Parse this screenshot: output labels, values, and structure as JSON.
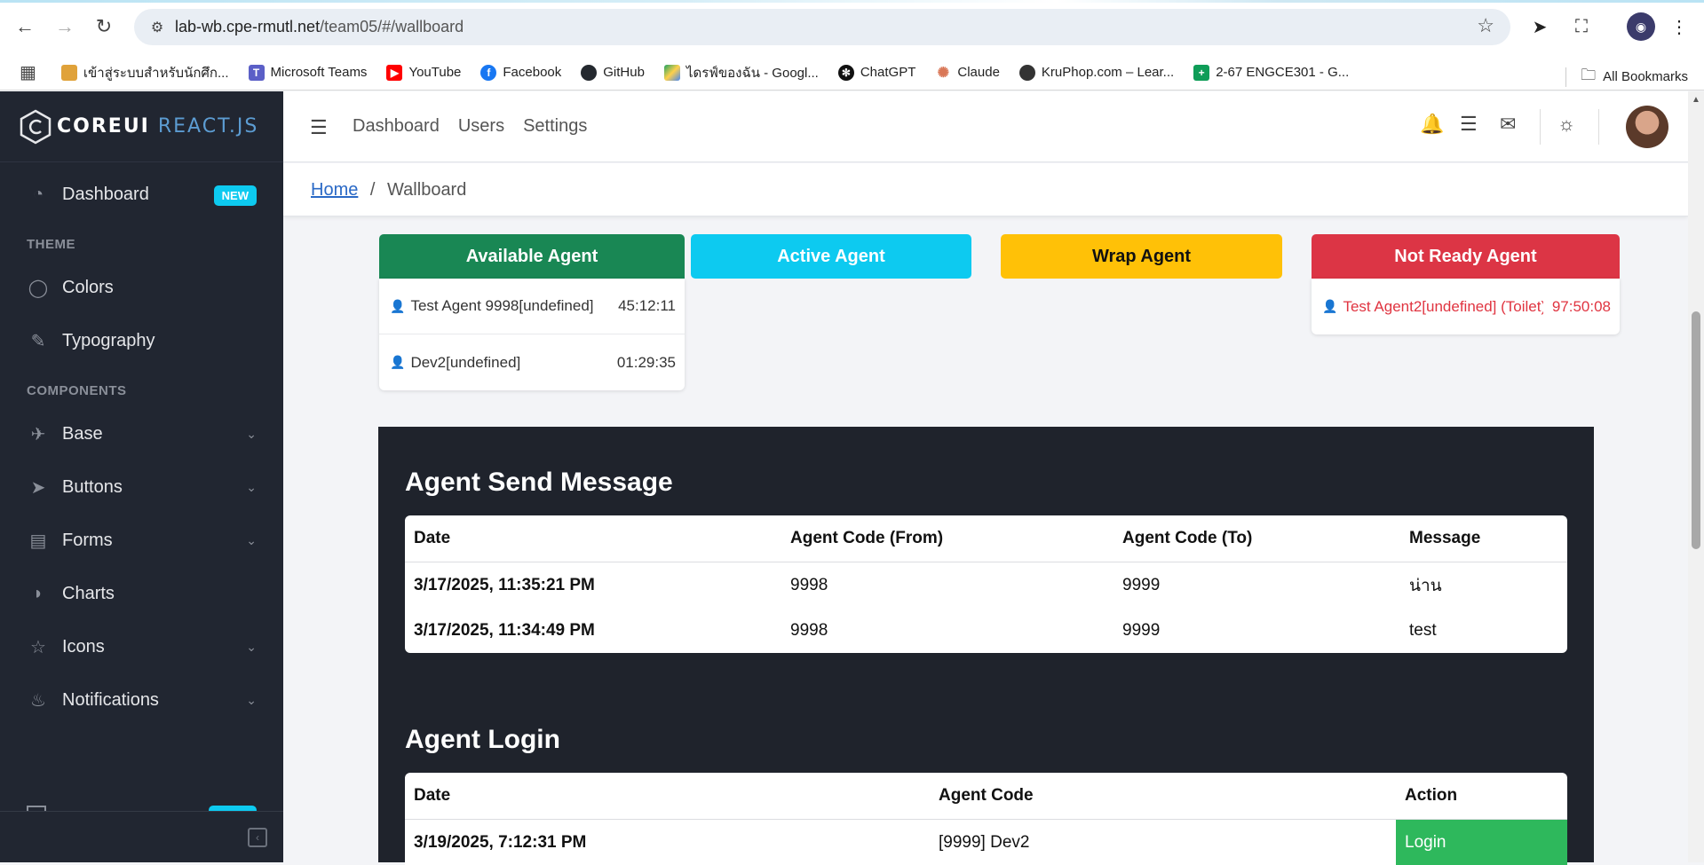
{
  "browser": {
    "url_host": "lab-wb.cpe-rmutl.net",
    "url_path": "/team05/#/wallboard",
    "bookmarks": [
      {
        "label": "เข้าสู่ระบบสำหรับนักศึก...",
        "icon": "torch-icon",
        "color": "#e0a23a"
      },
      {
        "label": "Microsoft Teams",
        "icon": "teams-icon",
        "color": "#5b5fc7"
      },
      {
        "label": "YouTube",
        "icon": "youtube-icon",
        "color": "#ff0000"
      },
      {
        "label": "Facebook",
        "icon": "facebook-icon",
        "color": "#1877f2"
      },
      {
        "label": "GitHub",
        "icon": "github-icon",
        "color": "#24292f"
      },
      {
        "label": "ไดรฟ์ของฉัน - Googl...",
        "icon": "google-drive-icon",
        "color": "#1fa463"
      },
      {
        "label": "ChatGPT",
        "icon": "chatgpt-icon",
        "color": "#111111"
      },
      {
        "label": "Claude",
        "icon": "claude-icon",
        "color": "#d97757"
      },
      {
        "label": "KruPhop.com – Lear...",
        "icon": "kruphop-icon",
        "color": "#333333"
      },
      {
        "label": "2-67 ENGCE301 - G...",
        "icon": "sheets-icon",
        "color": "#0f9d58"
      }
    ],
    "all_bookmarks": "All Bookmarks"
  },
  "sidebar": {
    "brand_bold": "COREUI",
    "brand_light": "REACT.JS",
    "dashboard": {
      "label": "Dashboard",
      "badge": "NEW"
    },
    "theme_title": "THEME",
    "theme_items": [
      {
        "label": "Colors",
        "icon": "drop-icon"
      },
      {
        "label": "Typography",
        "icon": "pencil-icon"
      }
    ],
    "components_title": "COMPONENTS",
    "component_items": [
      {
        "label": "Base",
        "icon": "puzzle-icon",
        "has_children": true
      },
      {
        "label": "Buttons",
        "icon": "cursor-icon",
        "has_children": true
      },
      {
        "label": "Forms",
        "icon": "notes-icon",
        "has_children": true
      },
      {
        "label": "Charts",
        "icon": "chart-pie-icon",
        "has_children": false
      },
      {
        "label": "Icons",
        "icon": "star-icon",
        "has_children": true
      },
      {
        "label": "Notifications",
        "icon": "bell-icon",
        "has_children": true
      }
    ]
  },
  "header": {
    "nav": [
      "Dashboard",
      "Users",
      "Settings"
    ]
  },
  "breadcrumb": {
    "home": "Home",
    "separator": "/",
    "current": "Wallboard"
  },
  "agent_status": {
    "available": {
      "title": "Available Agent",
      "color": "#198754",
      "agents": [
        {
          "name": "Test Agent 9998[undefined]",
          "time": "45:12:11"
        },
        {
          "name": "Dev2[undefined]",
          "time": "01:29:35"
        }
      ]
    },
    "active": {
      "title": "Active Agent",
      "color": "#0dcaf0",
      "agents": []
    },
    "wrap": {
      "title": "Wrap Agent",
      "color": "#ffc107",
      "agents": []
    },
    "not_ready": {
      "title": "Not Ready Agent",
      "color": "#dc3545",
      "agents": [
        {
          "name": "Test Agent2[undefined] (Toilet)",
          "time": "97:50:08"
        }
      ]
    }
  },
  "messages": {
    "title": "Agent Send Message",
    "columns": [
      "Date",
      "Agent Code (From)",
      "Agent Code (To)",
      "Message"
    ],
    "rows": [
      [
        "3/17/2025, 11:35:21 PM",
        "9998",
        "9999",
        "น่าน"
      ],
      [
        "3/17/2025, 11:34:49 PM",
        "9998",
        "9999",
        "test"
      ]
    ]
  },
  "login": {
    "title": "Agent Login",
    "columns": [
      "Date",
      "Agent Code",
      "Action"
    ],
    "rows": [
      [
        "3/19/2025, 7:12:31 PM",
        "[9999] Dev2",
        "Login"
      ]
    ],
    "action_color": "#2eb85c"
  }
}
